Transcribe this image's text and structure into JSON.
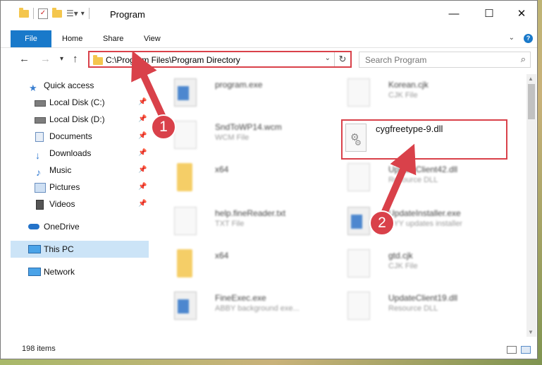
{
  "window": {
    "title": "Program",
    "minimize_glyph": "—",
    "maximize_glyph": "☐",
    "close_glyph": "✕"
  },
  "ribbon": {
    "tabs": [
      "File",
      "Home",
      "Share",
      "View"
    ]
  },
  "address": {
    "path": "C:\\Program Files\\Program Directory"
  },
  "search": {
    "placeholder": "Search Program"
  },
  "sidebar": {
    "items": [
      {
        "label": "Quick access",
        "icon": "star-icon",
        "pinned": false
      },
      {
        "label": "Local Disk (C:)",
        "icon": "drive-icon",
        "pinned": true
      },
      {
        "label": "Local Disk (D:)",
        "icon": "drive-icon",
        "pinned": true
      },
      {
        "label": "Documents",
        "icon": "documents-icon",
        "pinned": true
      },
      {
        "label": "Downloads",
        "icon": "download-icon",
        "pinned": true
      },
      {
        "label": "Music",
        "icon": "music-icon",
        "pinned": true
      },
      {
        "label": "Pictures",
        "icon": "pictures-icon",
        "pinned": true
      },
      {
        "label": "Videos",
        "icon": "videos-icon",
        "pinned": true
      },
      {
        "label": "OneDrive",
        "icon": "cloud-icon",
        "pinned": false
      },
      {
        "label": "This PC",
        "icon": "monitor-icon",
        "pinned": false
      },
      {
        "label": "Network",
        "icon": "network-icon",
        "pinned": false
      }
    ]
  },
  "files": [
    {
      "name": "program.exe",
      "type": ""
    },
    {
      "name": "Korean.cjk",
      "type": "CJK File"
    },
    {
      "name": "SndToWP14.wcm",
      "type": "WCM File"
    },
    {
      "name": "x64",
      "type": ""
    },
    {
      "name": "UpdateClient42.dll",
      "type": "Resource DLL"
    },
    {
      "name": "help.fineReader.txt",
      "type": "TXT File"
    },
    {
      "name": "UpdateInstaller.exe",
      "type": "BYY updates installer"
    },
    {
      "name": "x64",
      "type": ""
    },
    {
      "name": "gtd.cjk",
      "type": "CJK File"
    },
    {
      "name": "FineExec.exe",
      "type": "ABBY background exe..."
    },
    {
      "name": "UpdateClient19.dll",
      "type": "Resource DLL"
    }
  ],
  "highlighted_file": {
    "name": "cygfreetype-9.dll"
  },
  "status": {
    "item_count": "198 items"
  },
  "annotations": {
    "step1": "1",
    "step2": "2",
    "color": "#d9414a"
  },
  "colors": {
    "accent": "#1979ca",
    "selection": "#cce4f7",
    "highlight": "#d9414a"
  }
}
